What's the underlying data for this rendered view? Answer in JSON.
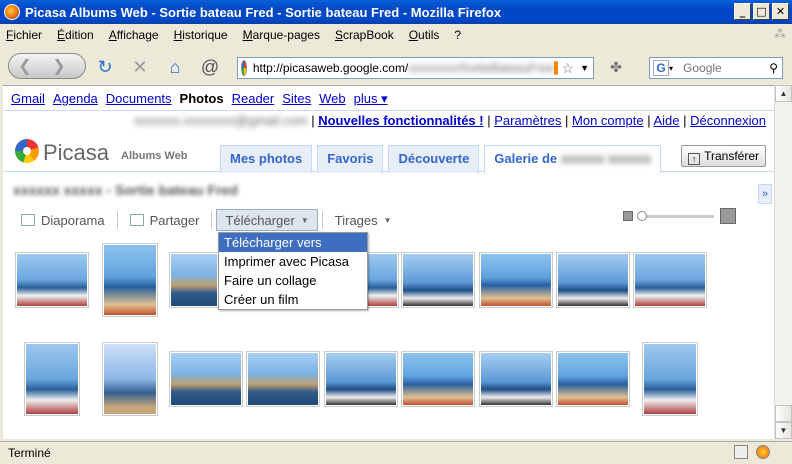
{
  "window": {
    "title": "Picasa Albums Web - Sortie bateau Fred - Sortie bateau Fred - Mozilla Firefox"
  },
  "menu": [
    "Fichier",
    "Édition",
    "Affichage",
    "Historique",
    "Marque-pages",
    "ScrapBook",
    "Outils",
    "?"
  ],
  "address": {
    "url": "http://picasaweb.google.com/",
    "url_blur": "xxxxxxxx/SortieBateauFred"
  },
  "search": {
    "engine": "G",
    "placeholder": "Google"
  },
  "google_bar": {
    "links": [
      "Gmail",
      "Agenda",
      "Documents",
      "Photos",
      "Reader",
      "Sites",
      "Web",
      "plus ▾"
    ],
    "current": "Photos"
  },
  "user": {
    "email_blur": "xxxxxxx.xxxxxxxx@gmail.com",
    "links": [
      "Nouvelles fonctionnalités !",
      "Paramètres",
      "Mon compte",
      "Aide",
      "Déconnexion"
    ]
  },
  "brand": {
    "name": "Picasa",
    "sub": "Albums Web"
  },
  "tabs": [
    "Mes photos",
    "Favoris",
    "Découverte",
    "Galerie de"
  ],
  "tabs_gallery_owner_blur": "xxxxxx xxxxxx",
  "upload_label": "Transférer",
  "album": {
    "title_blur": "xxxxxx xxxxx - Sortie bateau Fred"
  },
  "toolbar": {
    "slideshow": "Diaporama",
    "share": "Partager",
    "download": "Télécharger",
    "prints": "Tirages"
  },
  "download_menu": [
    "Télécharger vers Picasa",
    "Imprimer avec Picasa",
    "Faire un collage",
    "Créer un film"
  ],
  "status": {
    "text": "Terminé"
  },
  "colors": {
    "title_blue": "#0346c3",
    "link": "#0000cc",
    "tab_text": "#3366cc",
    "menu_highlight": "#3e6ebf"
  }
}
